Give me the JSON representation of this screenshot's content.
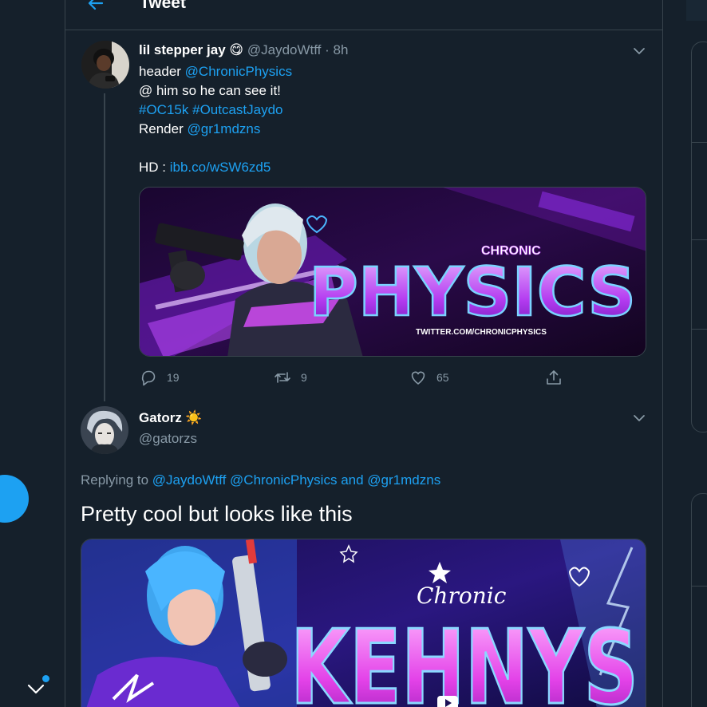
{
  "header": {
    "title": "Tweet"
  },
  "main_tweet": {
    "display_name": "lil stepper jay",
    "emoji": "😋",
    "handle": "@JaydoWtff",
    "separator": "·",
    "time": "8h",
    "lines": {
      "l1_text": "header ",
      "l1_mention": "@ChronicPhysics",
      "l2_text": "@ him so he can see it!",
      "l3_tag1": "#OC15k",
      "l3_tag2": "#OutcastJaydo",
      "l4_text": "Render ",
      "l4_mention": "@gr1mdzns",
      "l5_text": "HD : ",
      "l5_link": "ibb.co/wSW6zd5"
    },
    "image": {
      "small_title": "CHRONIC",
      "big_title": "PHYSICS",
      "url_text": "TWITTER.COM/CHRONICPHYSICS"
    },
    "stats": {
      "replies": "19",
      "retweets": "9",
      "likes": "65"
    }
  },
  "reply_tweet": {
    "display_name": "Gatorz",
    "emoji": "☀️",
    "handle": "@gatorzs",
    "replying_prefix": "Replying to ",
    "replying_to": [
      "@JaydoWtff",
      "@ChronicPhysics",
      "@gr1mdzns"
    ],
    "replying_and": "and",
    "text": "Pretty cool but looks like this",
    "image": {
      "small_title": "Chronic",
      "big_title": "KEHNYS"
    }
  },
  "colors": {
    "bg": "#15202b",
    "accent": "#1da1f2",
    "border": "#38444d",
    "muted": "#8899a6"
  }
}
